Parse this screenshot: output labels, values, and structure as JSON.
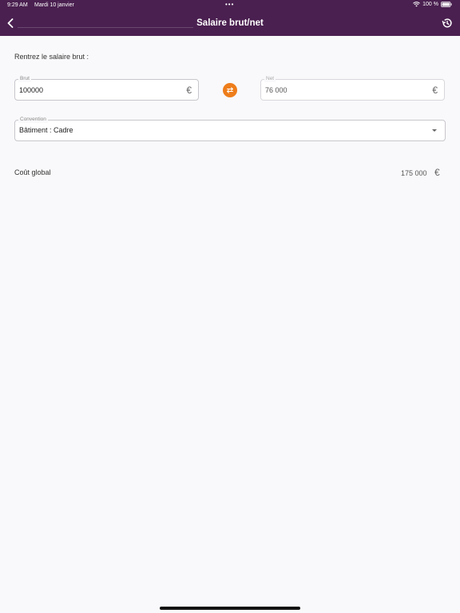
{
  "status_bar": {
    "time": "9:29 AM",
    "date": "Mardi 10 janvier",
    "dots": "•••",
    "battery": "100 %"
  },
  "nav": {
    "title": "Salaire brut/net",
    "back_icon": "chevron-left-icon",
    "history_icon": "history-icon"
  },
  "form": {
    "prompt": "Rentrez le salaire brut :",
    "gross": {
      "label": "Brut",
      "value": "100000",
      "currency": "€"
    },
    "net": {
      "label": "Net",
      "value": "76 000",
      "currency": "€"
    },
    "swap_icon": "swap-icon",
    "convention": {
      "label": "Convention",
      "value": "Bâtiment : Cadre"
    }
  },
  "result": {
    "label": "Coût global",
    "value": "175 000",
    "currency": "€"
  },
  "colors": {
    "header": "#4a2050",
    "accent": "#ee7d1b",
    "background": "#f9f8fa"
  }
}
